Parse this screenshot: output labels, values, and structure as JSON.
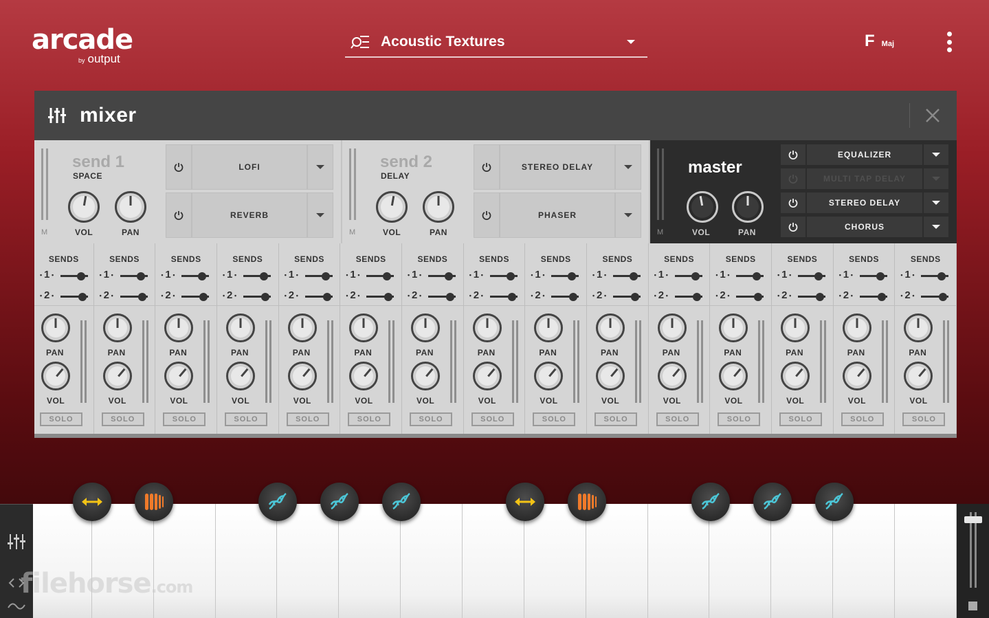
{
  "app": {
    "logo": "arcade",
    "logo_by": "by",
    "logo_brand": "output"
  },
  "preset": {
    "name": "Acoustic Textures",
    "icon": "preset-browser-icon"
  },
  "key": {
    "note": "F",
    "mode": "Maj"
  },
  "mixer": {
    "title": "mixer",
    "sends": [
      {
        "name": "send 1",
        "sub": "SPACE",
        "m_label": "M",
        "vol_label": "VOL",
        "pan_label": "PAN",
        "fx": [
          "LOFI",
          "REVERB"
        ]
      },
      {
        "name": "send 2",
        "sub": "DELAY",
        "m_label": "M",
        "vol_label": "VOL",
        "pan_label": "PAN",
        "fx": [
          "STEREO DELAY",
          "PHASER"
        ]
      }
    ],
    "master": {
      "name": "master",
      "m_label": "M",
      "vol_label": "VOL",
      "pan_label": "PAN",
      "fx": [
        {
          "name": "EQUALIZER",
          "enabled": true
        },
        {
          "name": "MULTI TAP DELAY",
          "enabled": false
        },
        {
          "name": "STEREO DELAY",
          "enabled": true
        },
        {
          "name": "CHORUS",
          "enabled": true
        }
      ]
    },
    "channel_labels": {
      "sends": "SENDS",
      "send1": "1",
      "send2": "2",
      "pan": "PAN",
      "vol": "VOL",
      "solo": "SOLO"
    },
    "channel_count": 15
  },
  "keyboard": {
    "white_keys": 15,
    "badges": [
      {
        "key_index": 1,
        "type": "stretch",
        "color": "#f3c316"
      },
      {
        "key_index": 2,
        "type": "stutter",
        "color": "#f07a2a"
      },
      {
        "key_index": 4,
        "type": "dna",
        "color": "#4cc5d6"
      },
      {
        "key_index": 5,
        "type": "dna",
        "color": "#4cc5d6"
      },
      {
        "key_index": 6,
        "type": "dna",
        "color": "#4cc5d6"
      },
      {
        "key_index": 8,
        "type": "stretch",
        "color": "#f3c316"
      },
      {
        "key_index": 9,
        "type": "stutter",
        "color": "#f07a2a"
      },
      {
        "key_index": 11,
        "type": "dna",
        "color": "#4cc5d6"
      },
      {
        "key_index": 12,
        "type": "dna",
        "color": "#4cc5d6"
      },
      {
        "key_index": 13,
        "type": "dna",
        "color": "#4cc5d6"
      }
    ]
  },
  "watermark": {
    "text": "filehorse",
    "suffix": ".com"
  }
}
